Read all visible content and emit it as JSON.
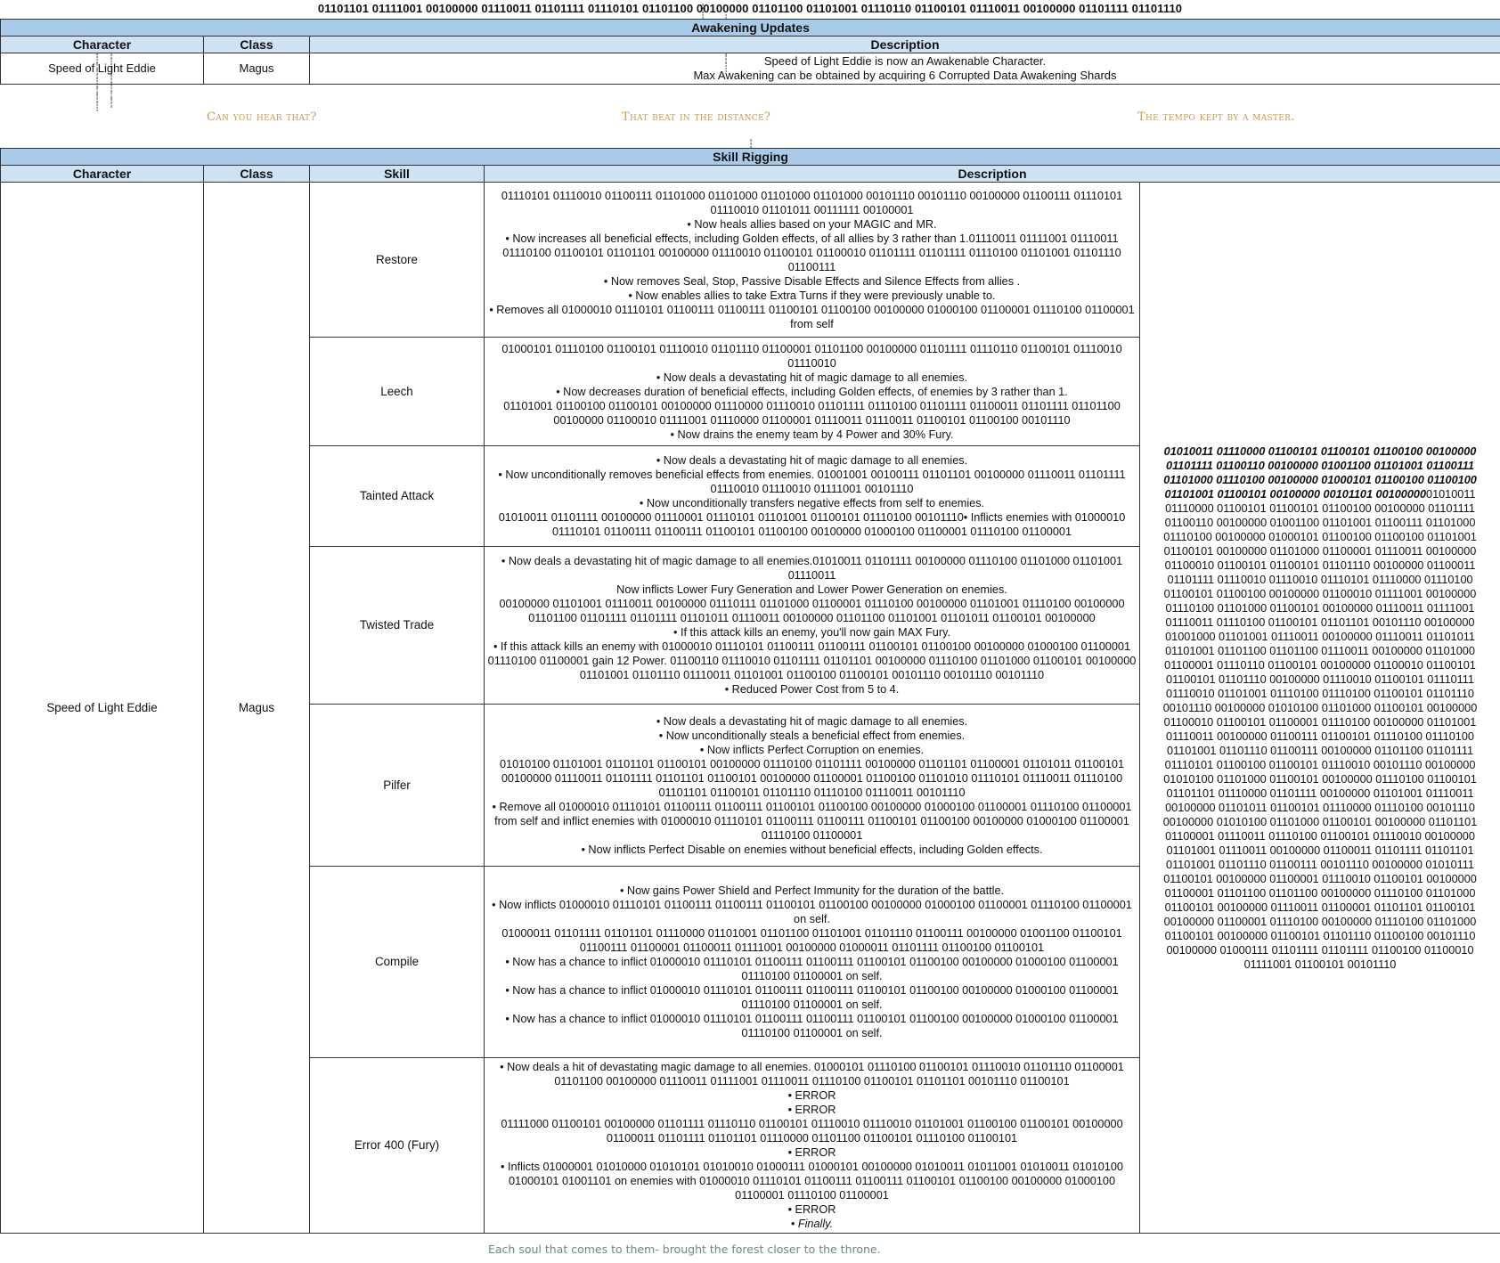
{
  "top_binary": "01101101 01111001 00100000 01110011 01101111 01110101 01101100 00100000 01101100 01101001 01110110 01100101 01110011 00100000 01101111 01101110",
  "awakening": {
    "title": "Awakening Updates",
    "headers": [
      "Character",
      "Class",
      "Description"
    ],
    "row": {
      "character": "Speed of Light Eddie",
      "class": "Magus",
      "description": [
        "Speed of Light Eddie is now an Awakenable Character.",
        "Max Awakening can be obtained by acquiring 6 Corrupted Data Awakening Shards"
      ]
    }
  },
  "quotes": [
    "Can you hear that?",
    "That beat in the distance?",
    "The tempo kept by a master."
  ],
  "skill_rigging": {
    "title": "Skill Rigging",
    "headers": [
      "Character",
      "Class",
      "Skill",
      "Description"
    ],
    "character": "Speed of Light Eddie",
    "class": "Magus",
    "skills": [
      {
        "name": "Restore",
        "lines": [
          "01110101 01110010 01100111 01101000 01101000 01101000 01101000 00101110 00101110 00100000 01100111 01110101 01110010 01101011 00111111 00100001",
          "• Now heals allies based on your MAGIC and MR.",
          "• Now increases all beneficial effects, including Golden effects, of all allies by 3 rather than 1.01110011 01111001 01110011 01110100 01100101 01101101 00100000 01110010 01100101 01100010 01101111 01101111 01110100 01101001 01101110 01100111",
          "• Now removes Seal, Stop, Passive Disable Effects and Silence Effects from allies .",
          "• Now enables allies to take Extra Turns if they were previously unable to.",
          "• Removes all 01000010 01110101 01100111 01100111 01100101 01100100 00100000 01000100 01100001 01110100 01100001 from self"
        ]
      },
      {
        "name": "Leech",
        "lines": [
          "01000101 01110100 01100101 01110010 01101110 01100001 01101100 00100000 01101111 01110110 01100101 01110010 01110010",
          "• Now deals a devastating hit of magic damage to all enemies.",
          "• Now decreases duration of beneficial effects, including Golden effects, of enemies by 3 rather than 1.",
          "01101001 01100100 01100101 00100000 01110000 01110010 01101111 01110100 01101111 01100011 01101111 01101100 00100000 01100010 01111001 01110000 01100001 01110011 01110011 01100101 01100100 00101110",
          "• Now drains the enemy team by 4 Power and 30% Fury."
        ]
      },
      {
        "name": "Tainted Attack",
        "lines": [
          "• Now deals a devastating hit of magic damage to all enemies.",
          "• Now unconditionally removes beneficial effects from enemies. 01001001 00100111 01101101 00100000 01110011 01101111 01110010 01110010 01111001 00101110",
          "• Now unconditionally transfers negative effects from self to enemies.",
          "01010011 01101111 00100000 01110001 01110101 01101001 01100101 01110100 00101110• Inflicts enemies with 01000010 01110101 01100111 01100111 01100101 01100100 00100000 01000100 01100001 01110100 01100001"
        ]
      },
      {
        "name": "Twisted Trade",
        "lines": [
          "• Now deals a devastating hit of magic damage to all enemies.01010011 01101111 00100000 01110100 01101000 01101001 01110011",
          "Now inflicts Lower Fury Generation and Lower Power Generation on enemies.",
          "00100000 01101001 01110011 00100000 01110111 01101000 01100001 01110100 00100000 01101001 01110100 00100000 01101100 01101111 01101111 01101011 01110011 00100000 01101100 01101001 01101011 01100101 00100000",
          "• If this attack kills an enemy, you'll now gain MAX Fury.",
          "• If this attack kills an enemy with 01000010 01110101 01100111 01100111 01100101 01100100 00100000 01000100 01100001 01110100 01100001 gain 12 Power. 01100110 01110010 01101111 01101101 00100000 01110100 01101000 01100101 00100000 01101001 01101110 01110011 01101001 01100100 01100101 00101110 00101110 00101110",
          "• Reduced Power Cost from 5 to 4."
        ]
      },
      {
        "name": "Pilfer",
        "lines": [
          "• Now deals a devastating hit of magic damage to all enemies.",
          "• Now unconditionally steals a beneficial effect from enemies.",
          "• Now inflicts Perfect Corruption on enemies.",
          "01010100 01101001 01101101 01100101 00100000 01110100 01101111 00100000 01101101 01100001 01101011 01100101 00100000 01110011 01101111 01101101 01100101 00100000 01100001 01100100 01101010 01110101 01110011 01110100 01101101 01100101 01101110 01110100 01110011 00101110",
          "• Remove all 01000010 01110101 01100111 01100111 01100101 01100100 00100000 01000100 01100001 01110100 01100001 from self and inflict enemies with 01000010 01110101 01100111 01100111 01100101 01100100 00100000 01000100 01100001 01110100 01100001",
          "• Now inflicts Perfect Disable on enemies without beneficial effects, including Golden effects."
        ]
      },
      {
        "name": "Compile",
        "lines": [
          "• Now gains Power Shield and Perfect Immunity for the duration of the battle.",
          "• Now inflicts 01000010 01110101 01100111 01100111 01100101 01100100 00100000 01000100 01100001 01110100 01100001 on self.",
          "01000011 01101111 01101101 01110000 01101001 01101100 01101001 01101110 01100111 00100000 01001100 01100101 01100111 01100001 01100011 01111001 00100000 01000011 01101111 01100100 01100101",
          "• Now has a chance to inflict 01000010 01110101 01100111 01100111 01100101 01100100 00100000 01000100 01100001 01110100 01100001 on self.",
          "• Now has a chance to inflict 01000010 01110101 01100111 01100111 01100101 01100100 00100000 01000100 01100001 01110100 01100001 on self.",
          "• Now has a chance to inflict 01000010 01110101 01100111 01100111 01100101 01100100 00100000 01000100 01100001 01110100 01100001 on self."
        ]
      },
      {
        "name": "Error 400 (Fury)",
        "lines": [
          "• Now deals a hit of devastating magic damage to all enemies. 01000101 01110100 01100101 01110010 01101110 01100001 01101100 00100000 01110011 01111001 01110011 01110100 01100101 01101101 00101110 01100101",
          "• ERROR",
          "• ERROR",
          "01111000 01100101 00100000 01101111 01110110 01100101 01110010 01110010 01101001 01100100 01100101 00100000 01100011 01101111 01101101 01110000 01101100 01100101 01110100 01100101",
          "• ERROR",
          "• Inflicts 01000001 01010000 01010101 01010010 01000111 01000101 00100000 01010011 01011001 01010011 01010100 01000101 01001101 on enemies with 01000010 01110101 01100111 01100111 01100101 01100100 00100000 01000100 01100001 01110100 01100001",
          "• ERROR",
          "• Finally."
        ]
      }
    ],
    "side_binary_bold": "01010011 01110000 01100101 01100101 01100100 00100000 01101111 01100110 00100000 01001100 01101001 01100111 01101000 01110100 00100000 01000101 01100100 01100100 01101001 01100101 00100000 00101101 00100000",
    "side_binary": "01010011 01110000 01100101 01100101 01100100 00100000 01101111 01100110 00100000 01001100 01101001 01100111 01101000 01110100 00100000 01000101 01100100 01100100 01101001 01100101 00100000 01101000 01100001 01110011 00100000 01100010 01100101 01100101 01101110 00100000 01100011 01101111 01110010 01110010 01110101 01110000 01110100 01100101 01100100 00100000 01100010 01111001 00100000 01110100 01101000 01100101 00100000 01110011 01111001 01110011 01110100 01100101 01101101 00101110 00100000 01001000 01101001 01110011 00100000 01110011 01101011 01101001 01101100 01101100 01110011 00100000 01101000 01100001 01110110 01100101 00100000 01100010 01100101 01100101 01101110 00100000 01110010 01100101 01110111 01110010 01101001 01110100 01110100 01100101 01101110 00101110 00100000 01010100 01101000 01100101 00100000 01100010 01100101 01100001 01110100 00100000 01101001 01110011 00100000 01100111 01100101 01110100 01110100 01101001 01101110 01100111 00100000 01101100 01101111 01110101 01100100 01100101 01110010 00101110 00100000 01010100 01101000 01100101 00100000 01110100 01100101 01101101 01110000 01101111 00100000 01101001 01110011 00100000 01101011 01100101 01110000 01110100 00101110 00100000 01010100 01101000 01100101 00100000 01101101 01100001 01110011 01110100 01100101 01110010 00100000 01101001 01110011 00100000 01100011 01101111 01101101 01101001 01101110 01100111 00101110 00100000 01010111 01100101 00100000 01100001 01110010 01100101 00100000 01100001 01101100 01101100 00100000 01110100 01101000 01100101 00100000 01110011 01100001 01101101 01100101 00100000 01100001 01110100 00100000 01110100 01101000 01100101 00100000 01100101 01101110 01100100 00101110 00100000 01000111 01101111 01101111 01100100 01100010 01111001 01100101 00101110"
  },
  "footer": "Each soul that comes to them- brought the forest closer to the throne."
}
